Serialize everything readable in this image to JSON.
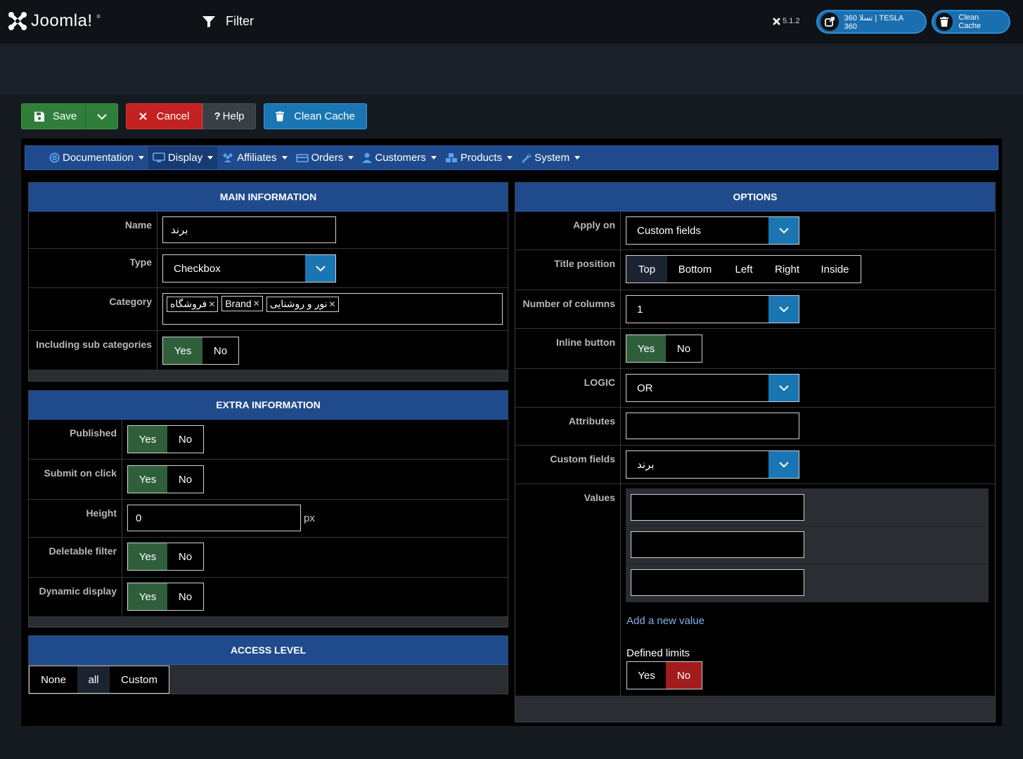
{
  "header": {
    "logo_text": "Joomla!",
    "logo_tm": "®",
    "page_title": "Filter",
    "version": "5.1.2",
    "site_link": "تسلا 360 | TESLA 360",
    "clean_cache": "Clean Cache"
  },
  "toolbar": {
    "save_label": "Save",
    "cancel_label": "Cancel",
    "help_label": "Help",
    "help_mark": "?",
    "clean_cache_label": "Clean Cache"
  },
  "nav": {
    "items": [
      {
        "label": "Documentation",
        "icon": "life-ring-icon"
      },
      {
        "label": "Display",
        "icon": "monitor-icon"
      },
      {
        "label": "Affiliates",
        "icon": "users-icon"
      },
      {
        "label": "Orders",
        "icon": "credit-card-icon"
      },
      {
        "label": "Customers",
        "icon": "user-icon"
      },
      {
        "label": "Products",
        "icon": "cubes-icon"
      },
      {
        "label": "System",
        "icon": "wrench-icon"
      }
    ]
  },
  "main_info": {
    "title": "MAIN INFORMATION",
    "name_label": "Name",
    "name_value": "برند",
    "type_label": "Type",
    "type_value": "Checkbox",
    "category_label": "Category",
    "categories": [
      "فروشگاه",
      "Brand",
      "نور و روشنایی"
    ],
    "sub_categories_label": "Including sub categories",
    "yes": "Yes",
    "no": "No"
  },
  "extra_info": {
    "title": "EXTRA INFORMATION",
    "published_label": "Published",
    "submit_label": "Submit on click",
    "height_label": "Height",
    "height_value": "0",
    "height_unit": "px",
    "deletable_label": "Deletable filter",
    "dynamic_label": "Dynamic display",
    "yes": "Yes",
    "no": "No"
  },
  "access": {
    "title": "ACCESS LEVEL",
    "options": [
      "None",
      "all",
      "Custom"
    ],
    "selected": "all"
  },
  "options": {
    "title": "OPTIONS",
    "apply_label": "Apply on",
    "apply_value": "Custom fields",
    "title_pos_label": "Title position",
    "title_positions": [
      "Top",
      "Bottom",
      "Left",
      "Right",
      "Inside"
    ],
    "title_pos_selected": "Top",
    "columns_label": "Number of columns",
    "columns_value": "1",
    "inline_label": "Inline button",
    "logic_label": "LOGIC",
    "logic_value": "OR",
    "attributes_label": "Attributes",
    "custom_fields_label": "Custom fields",
    "custom_fields_value": "برند",
    "values_label": "Values",
    "add_value": "Add a new value",
    "defined_limits": "Defined limits",
    "yes": "Yes",
    "no": "No"
  }
}
